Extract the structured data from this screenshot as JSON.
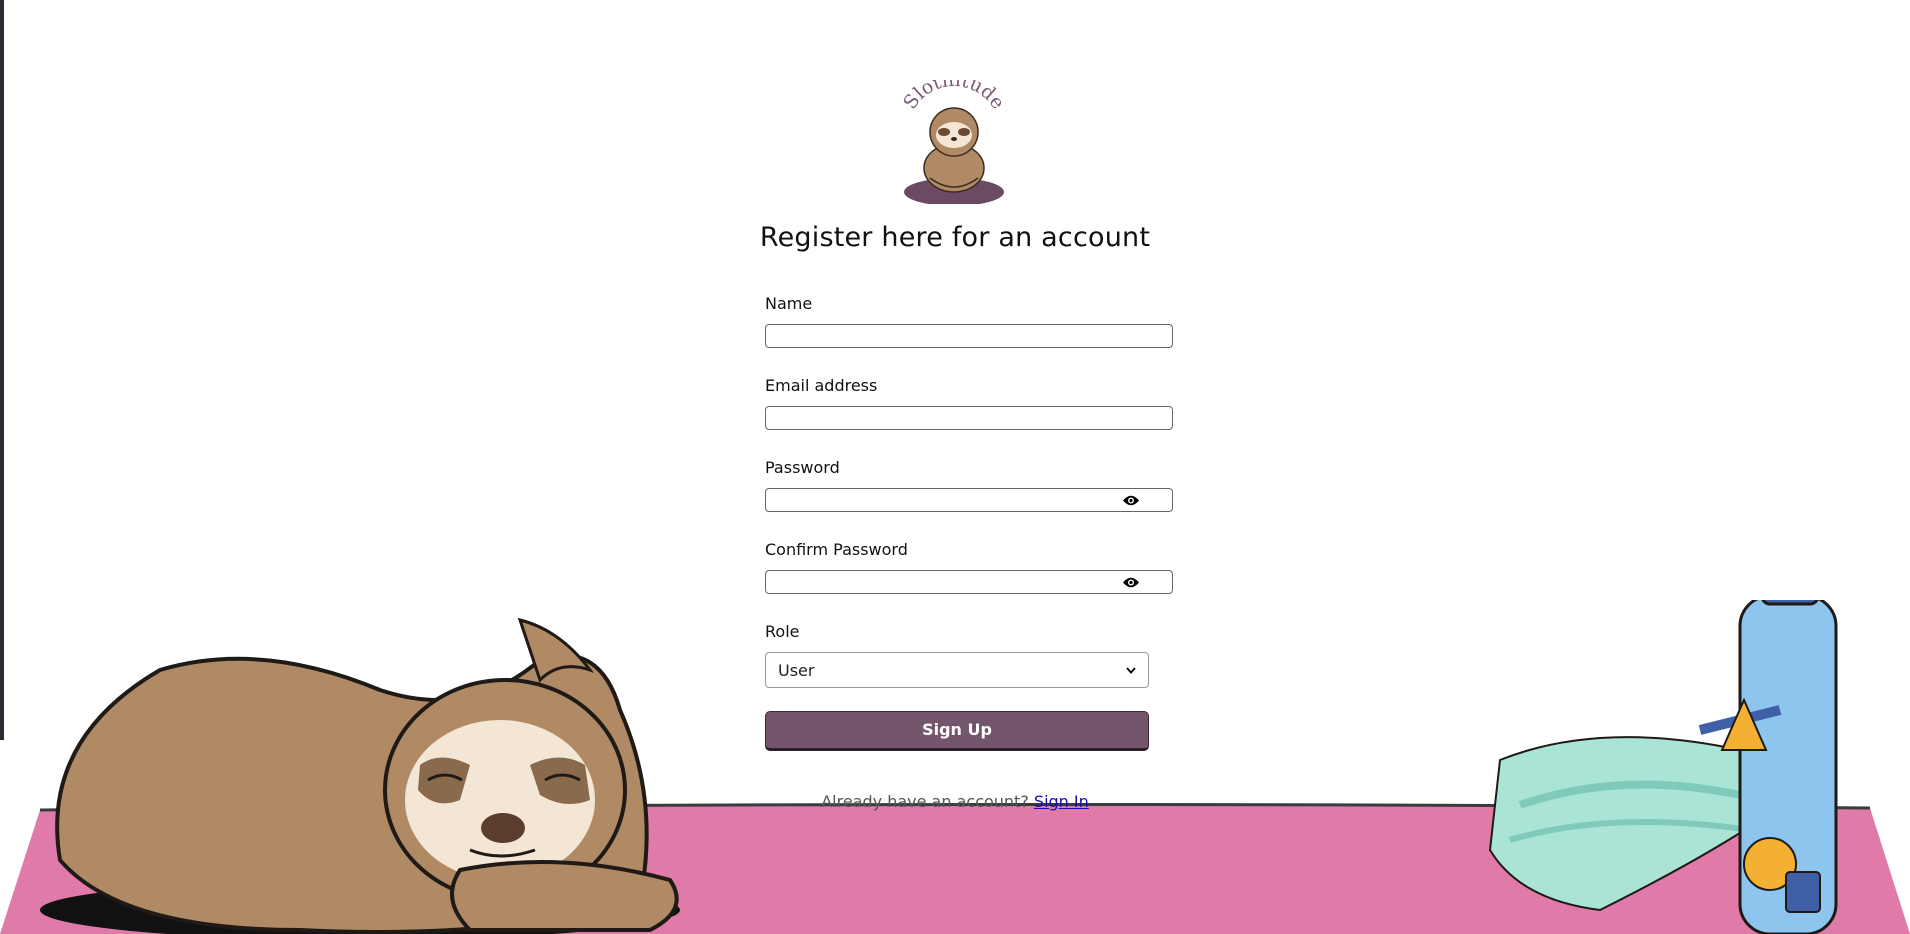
{
  "brand": {
    "name": "Slothitude"
  },
  "page": {
    "title": "Register here for an account"
  },
  "form": {
    "name": {
      "label": "Name",
      "value": ""
    },
    "email": {
      "label": "Email address",
      "value": ""
    },
    "password": {
      "label": "Password",
      "value": ""
    },
    "confirm_password": {
      "label": "Confirm Password",
      "value": ""
    },
    "role": {
      "label": "Role",
      "selected": "User"
    },
    "submit_label": "Sign Up"
  },
  "footer": {
    "prompt": "Already have an account?",
    "link": "Sign In"
  },
  "colors": {
    "accent": "#73566b",
    "mat": "#e07aa8",
    "link": "#1a0dab"
  },
  "icons": {
    "password_toggle": "eye-icon",
    "select_arrow": "chevron-down-icon"
  }
}
